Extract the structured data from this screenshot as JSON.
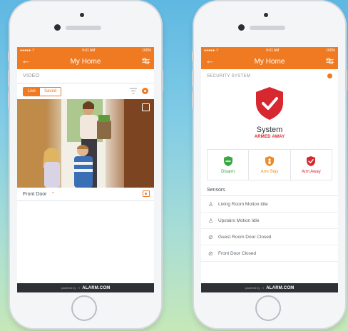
{
  "statusbar": {
    "carrier": "●●●●● ⌔",
    "time": "9:41 AM",
    "battery": "100%"
  },
  "left_screen": {
    "title": "My Home",
    "section_label": "VIDEO",
    "toggle": {
      "live": "Live",
      "saved": "Saved"
    },
    "camera_name": "Front Door",
    "camera_chevron": "⌃"
  },
  "right_screen": {
    "title": "My Home",
    "section_label": "SECURITY SYSTEM",
    "system_name": "System",
    "system_status": "ARMED AWAY",
    "arm_buttons": [
      {
        "label": "Disarm",
        "color": "#3aa645"
      },
      {
        "label": "Arm Stay",
        "color": "#f08a24"
      },
      {
        "label": "Arm Away",
        "color": "#d7272f"
      }
    ],
    "sensors_label": "Sensors",
    "sensors": [
      {
        "icon": "person-icon",
        "glyph": "🚶",
        "label": "Living Room Motion Idle"
      },
      {
        "icon": "person-icon",
        "glyph": "🚶",
        "label": "Upstairs Motion Idle"
      },
      {
        "icon": "door-icon",
        "glyph": "⊘",
        "label": "Guest Room Door Closed"
      },
      {
        "icon": "door-icon",
        "glyph": "⊘",
        "label": "Front Door Closed"
      }
    ]
  },
  "footer": {
    "powered": "powered by",
    "brand": "ALARM.COM"
  },
  "colors": {
    "accent": "#ef7a22",
    "armed": "#d7272f",
    "footer": "#2d3136"
  }
}
